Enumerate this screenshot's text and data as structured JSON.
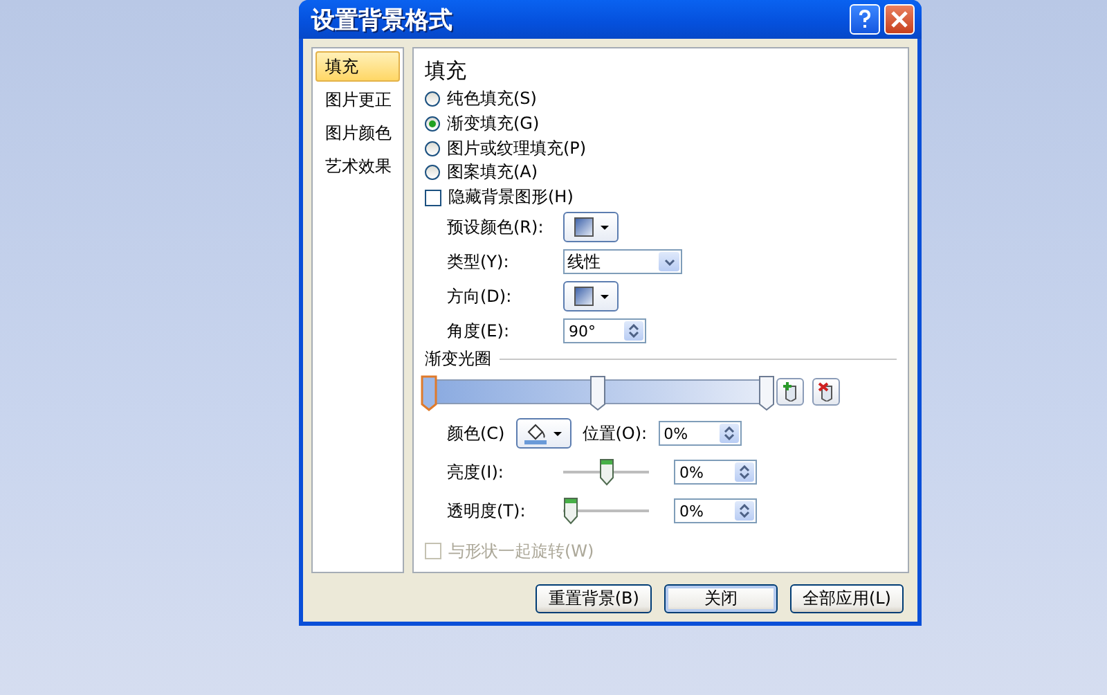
{
  "window": {
    "title": "设置背景格式"
  },
  "sidebar": {
    "items": [
      {
        "label": "填充",
        "selected": true
      },
      {
        "label": "图片更正",
        "selected": false
      },
      {
        "label": "图片颜色",
        "selected": false
      },
      {
        "label": "艺术效果",
        "selected": false
      }
    ]
  },
  "fill": {
    "heading": "填充",
    "options": [
      {
        "label": "纯色填充(S)",
        "selected": false
      },
      {
        "label": "渐变填充(G)",
        "selected": true
      },
      {
        "label": "图片或纹理填充(P)",
        "selected": false
      },
      {
        "label": "图案填充(A)",
        "selected": false
      }
    ],
    "hide_background": {
      "label": "隐藏背景图形(H)",
      "checked": false
    },
    "preset": {
      "label": "预设颜色(R):"
    },
    "type": {
      "label": "类型(Y):",
      "value": "线性"
    },
    "direction": {
      "label": "方向(D):"
    },
    "angle": {
      "label": "角度(E):",
      "value": "90°"
    },
    "stops_label": "渐变光圈",
    "stops": [
      {
        "level": 0,
        "selected": true
      },
      {
        "level": 0.5,
        "selected": false
      },
      {
        "level": 1,
        "selected": false
      }
    ],
    "color": {
      "label": "颜色(C)"
    },
    "position": {
      "label": "位置(O):",
      "value": "0%"
    },
    "brightness": {
      "label": "亮度(I):",
      "level": 0.5,
      "value": "0%"
    },
    "transparency": {
      "label": "透明度(T):",
      "level": 0,
      "value": "0%"
    },
    "rotate": {
      "label": "与形状一起旋转(W)",
      "checked": false,
      "disabled": true
    }
  },
  "buttons": [
    {
      "label": "重置背景(B)",
      "selected": false
    },
    {
      "label": "关闭",
      "selected": true
    },
    {
      "label": "全部应用(L)",
      "selected": false
    }
  ]
}
